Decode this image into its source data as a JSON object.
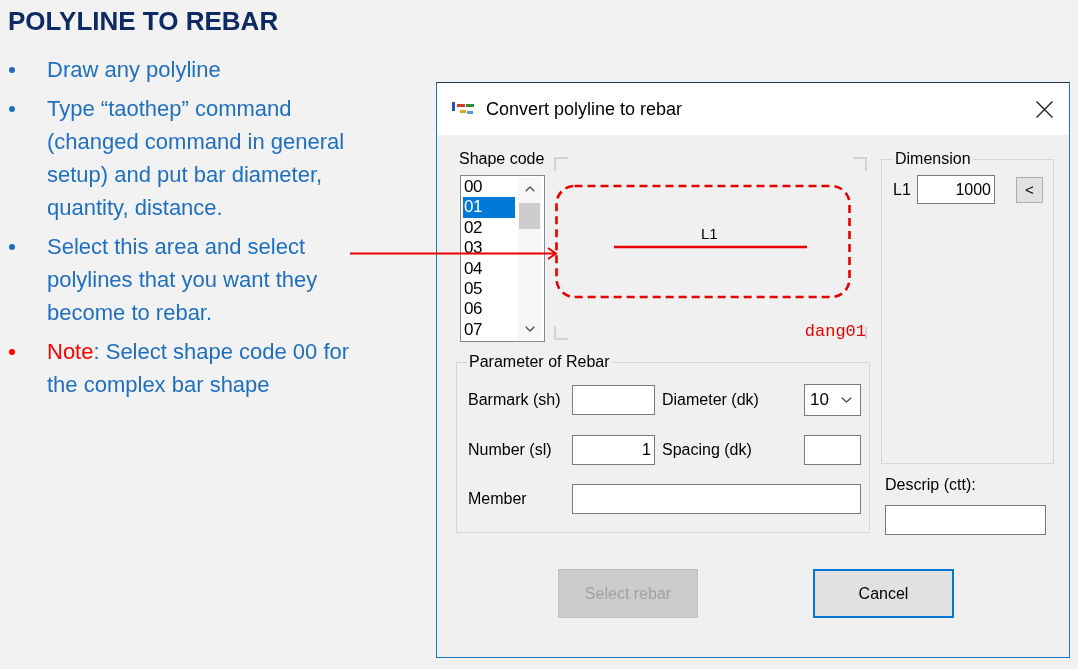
{
  "slide": {
    "title": "POLYLINE TO REBAR",
    "bullets": [
      {
        "text": "Draw any polyline",
        "color": "#1f6fc0"
      },
      {
        "text": "Type “taothep” command (changed command in general setup) and put bar diameter, quantity, distance.",
        "color": "#1f6fc0"
      },
      {
        "text": "Select this area and select polylines that you want they become to rebar.",
        "color": "#1f6fc0"
      },
      {
        "lead": "Note",
        "text": ": Select shape code 00 for the complex bar shape",
        "color": "#ff0000"
      }
    ]
  },
  "dialog": {
    "title": "Convert polyline to rebar",
    "shape_code": {
      "label": "Shape code",
      "items": [
        {
          "text": "00",
          "selected": false
        },
        {
          "text": "01",
          "selected": true
        },
        {
          "text": "02",
          "selected": false
        },
        {
          "text": "03",
          "selected": false
        },
        {
          "text": "04",
          "selected": false
        },
        {
          "text": "05",
          "selected": false
        },
        {
          "text": "06",
          "selected": false
        },
        {
          "text": "07",
          "selected": false
        }
      ]
    },
    "preview": {
      "dimension": "L1",
      "shape_name": "dang01"
    },
    "dimension": {
      "title": "Dimension",
      "label": "L1",
      "value": "1000",
      "button": "<"
    },
    "description": {
      "label": "Descrip (ctt):"
    },
    "parameters": {
      "title": "Parameter of Rebar",
      "fields": [
        {
          "label": "Barmark (sh)",
          "kind": "text"
        },
        {
          "label": "Diameter (dk)",
          "kind": "dropdown",
          "value": "10"
        },
        {
          "label": "Number (sl)",
          "kind": "number",
          "value": "1"
        },
        {
          "label": "Spacing (dk)",
          "kind": "text"
        },
        {
          "label": "Member",
          "kind": "wide"
        }
      ]
    },
    "buttons": [
      {
        "label": "Select rebar",
        "disabled": true,
        "focused": false
      },
      {
        "label": "Cancel",
        "disabled": false,
        "focused": true
      }
    ]
  }
}
